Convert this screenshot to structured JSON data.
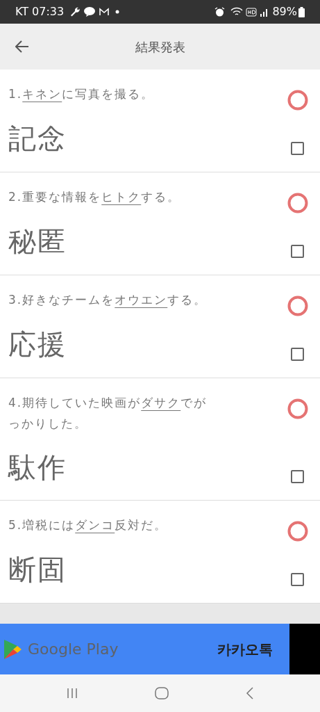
{
  "status_bar": {
    "carrier_time": "KT 07:33",
    "battery": "89%"
  },
  "header": {
    "title": "結果発表"
  },
  "questions": [
    {
      "number": "1.",
      "target": "キネン",
      "after": "に写真を撮る。",
      "answer": "記念",
      "correct": true,
      "checked": false
    },
    {
      "number": "2.",
      "before": "重要な情報を",
      "target": "ヒトク",
      "after": "する。",
      "answer": "秘匿",
      "correct": true,
      "checked": false
    },
    {
      "number": "3.",
      "before": "好きなチームを",
      "target": "オウエン",
      "after": "する。",
      "answer": "応援",
      "correct": true,
      "checked": false
    },
    {
      "number": "4.",
      "before": "期待していた映画が",
      "target": "ダサク",
      "after": "でがっかりした。",
      "answer": "駄作",
      "correct": true,
      "checked": false
    },
    {
      "number": "5.",
      "before": "増税には",
      "target": "ダンコ",
      "after": "反対だ。",
      "answer": "断固",
      "correct": true,
      "checked": false
    }
  ],
  "ad": {
    "store": "Google Play",
    "app": "카카오톡"
  }
}
